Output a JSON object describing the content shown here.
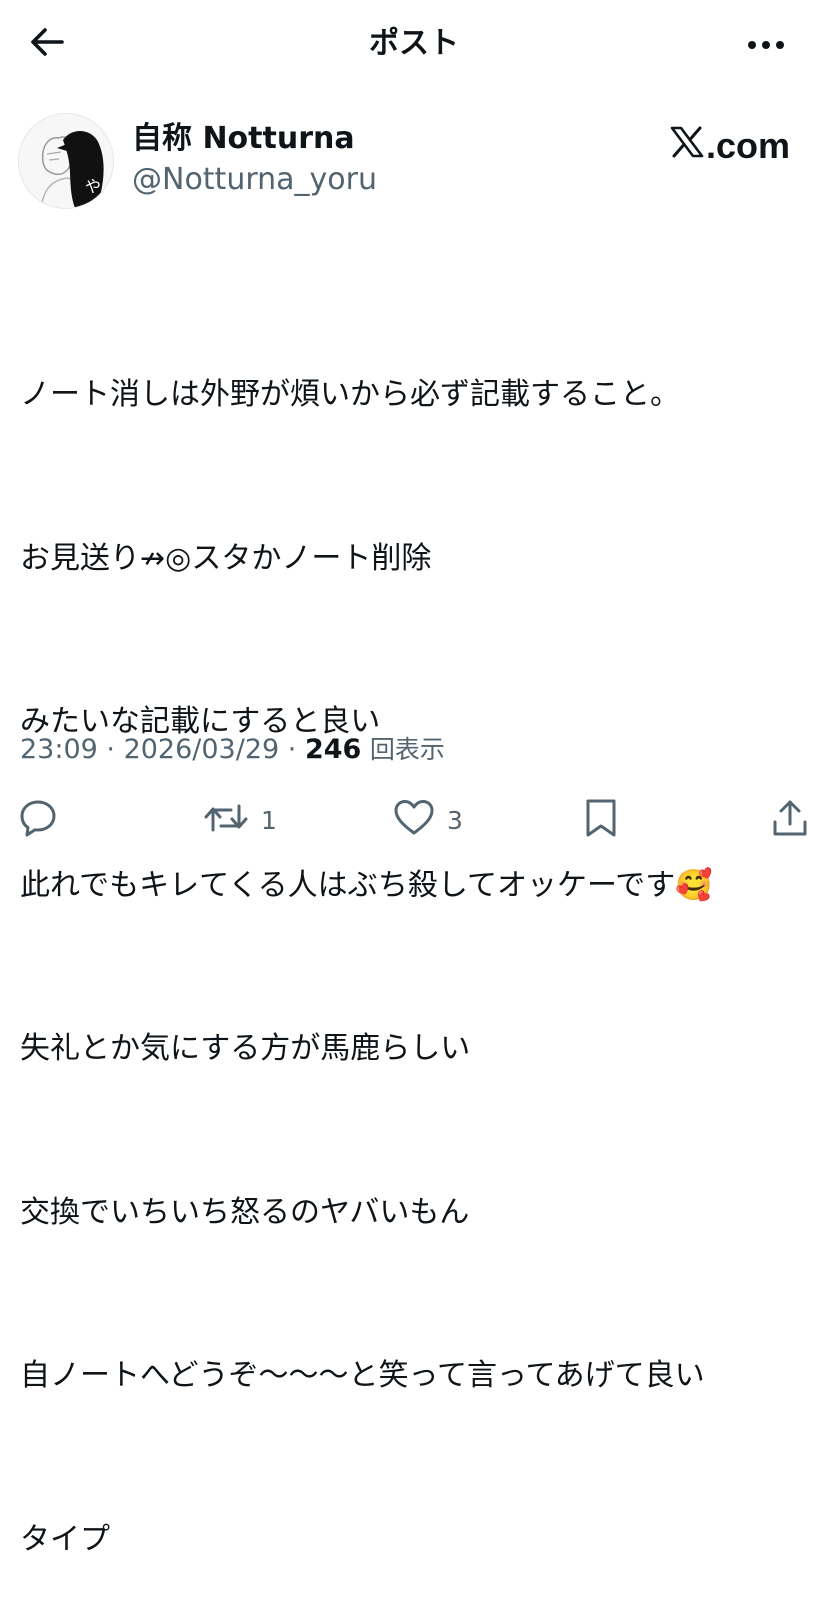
{
  "header": {
    "title": "ポスト"
  },
  "post": {
    "author": {
      "display_name": "自称 Notturna",
      "handle": "@Notturna_yoru",
      "avatar_glyph": "や"
    },
    "source_badge": {
      "label": ".com",
      "icon": "x-logo-icon"
    },
    "text_lines": [
      "ノート消しは外野が煩いから必ず記載すること。",
      "お見送り↛◎スタかノート削除",
      "みたいな記載にすると良い",
      "此れでもキレてくる人はぶち殺してオッケーです🥰",
      "失礼とか気にする方が馬鹿らしい",
      "交換でいちいち怒るのヤバいもん",
      "自ノートへどうぞ〜〜〜と笑って言ってあげて良い",
      "タイプ"
    ],
    "time": "23:09",
    "date": "2026/03/29",
    "separator": " · ",
    "views_count": "246",
    "views_label": "回表示"
  },
  "actions": {
    "reply_count": "",
    "repost_count": "1",
    "like_count": "3"
  },
  "colors": {
    "text": "#0f1419",
    "secondary": "#536471",
    "background": "#ffffff"
  }
}
